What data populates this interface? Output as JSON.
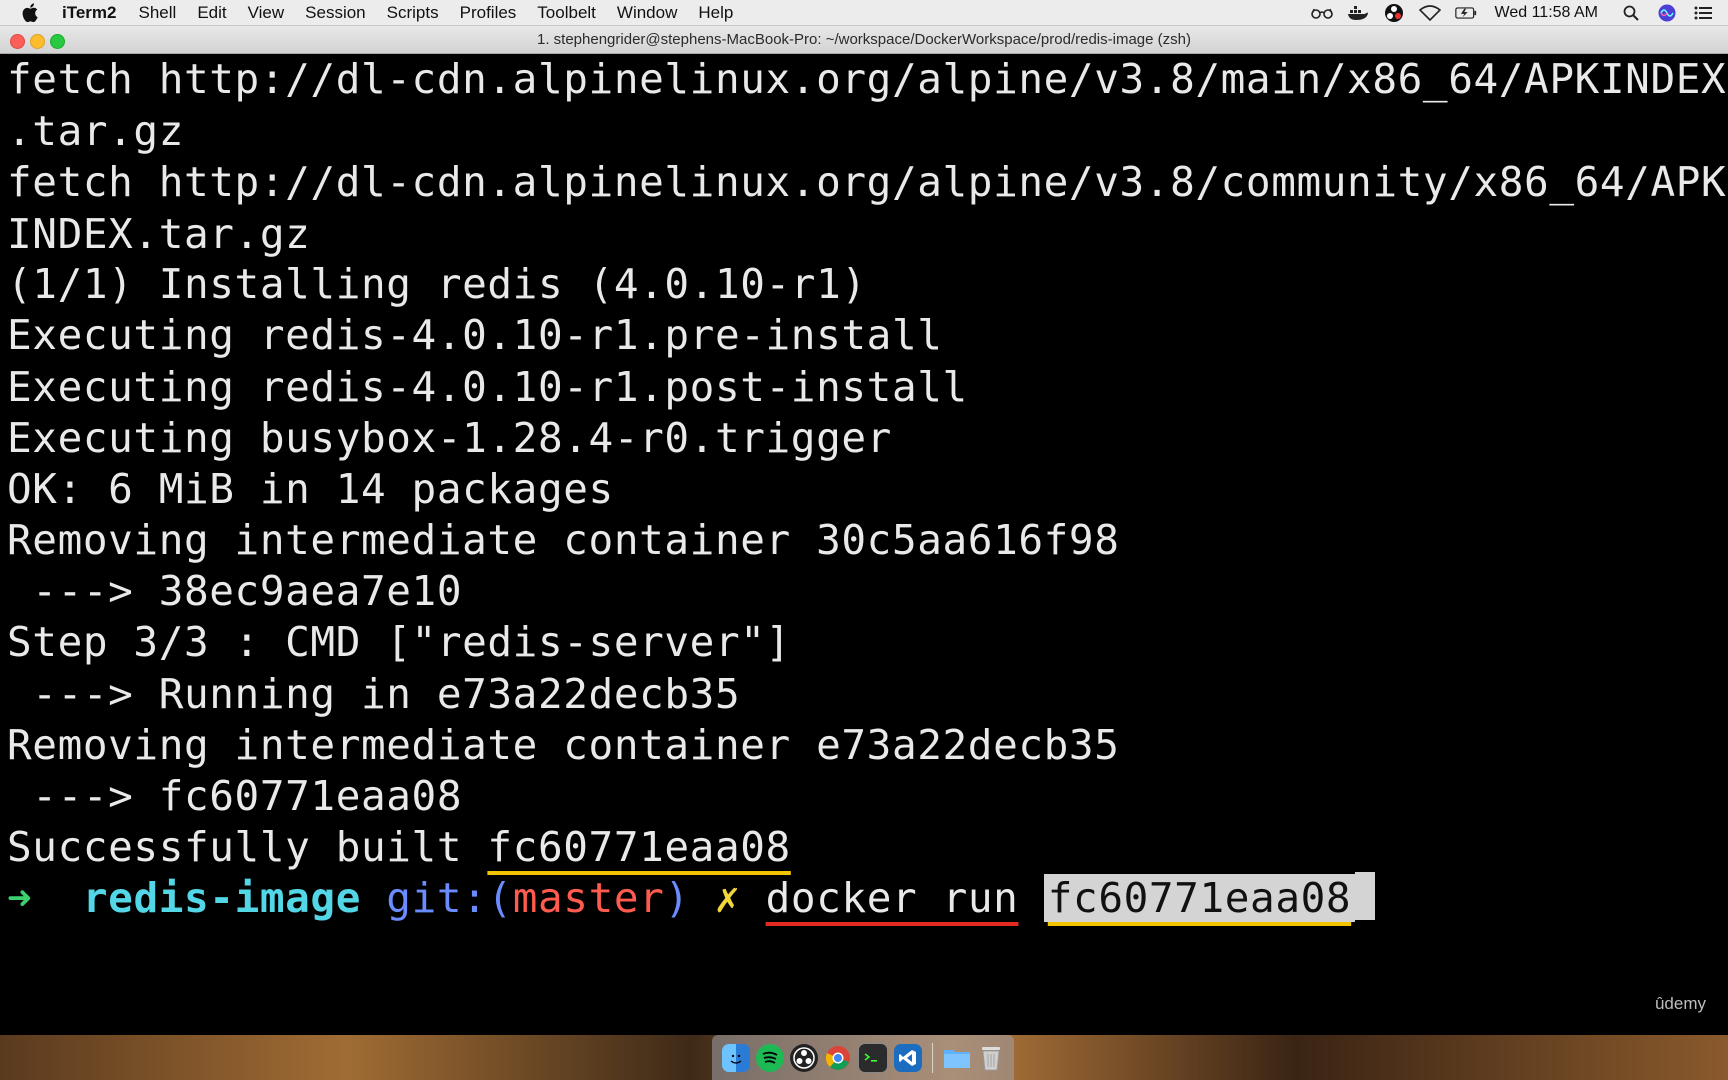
{
  "menubar": {
    "app_name": "iTerm2",
    "menus": [
      "Shell",
      "Edit",
      "View",
      "Session",
      "Scripts",
      "Profiles",
      "Toolbelt",
      "Window",
      "Help"
    ],
    "clock": "Wed 11:58 AM"
  },
  "window": {
    "title": "1. stephengrider@stephens-MacBook-Pro: ~/workspace/DockerWorkspace/prod/redis-image (zsh)"
  },
  "terminal": {
    "lines": [
      "fetch http://dl-cdn.alpinelinux.org/alpine/v3.8/main/x86_64/APKINDEX",
      ".tar.gz",
      "fetch http://dl-cdn.alpinelinux.org/alpine/v3.8/community/x86_64/APK",
      "INDEX.tar.gz",
      "(1/1) Installing redis (4.0.10-r1)",
      "Executing redis-4.0.10-r1.pre-install",
      "Executing redis-4.0.10-r1.post-install",
      "Executing busybox-1.28.4-r0.trigger",
      "OK: 6 MiB in 14 packages",
      "Removing intermediate container 30c5aa616f98",
      " ---> 38ec9aea7e10",
      "Step 3/3 : CMD [\"redis-server\"]",
      " ---> Running in e73a22decb35",
      "Removing intermediate container e73a22decb35",
      " ---> fc60771eaa08"
    ],
    "success_prefix": "Successfully built ",
    "success_id": "fc60771eaa08",
    "prompt": {
      "arrow": "➜",
      "dir": "redis-image",
      "git_label": "git:(",
      "branch": "master",
      "git_close": ")",
      "dirty": "✗",
      "command": "docker run",
      "argument": "fc60771eaa08"
    }
  },
  "watermark": "ûdemy",
  "colors": {
    "prompt_arrow": "#3bd16f",
    "prompt_dir": "#53d6e6",
    "git": "#6a8cff",
    "branch": "#ff5b4f",
    "dirty": "#f2d63a",
    "underline_yellow": "#f5c400",
    "underline_red": "#e22a22"
  },
  "dock": {
    "icons": [
      "finder-icon",
      "spotify-icon",
      "obs-icon",
      "chrome-icon",
      "terminal-icon",
      "vscode-icon",
      "folder-icon",
      "trash-icon"
    ]
  }
}
